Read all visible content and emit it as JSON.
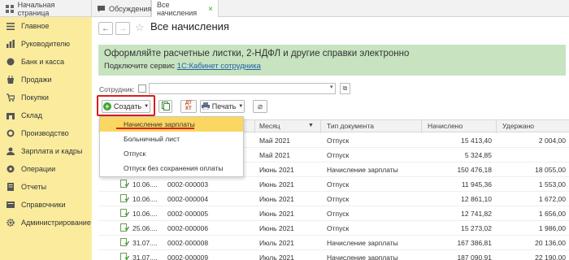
{
  "tabs": [
    {
      "label": "Начальная страница"
    },
    {
      "label": "Обсуждения"
    },
    {
      "label": "Все начисления",
      "close": "×"
    }
  ],
  "sidebar": {
    "items": [
      {
        "label": "Главное",
        "icon": "menu-icon"
      },
      {
        "label": "Руководителю",
        "icon": "chart-icon"
      },
      {
        "label": "Банк и касса",
        "icon": "bank-icon"
      },
      {
        "label": "Продажи",
        "icon": "sales-icon"
      },
      {
        "label": "Покупки",
        "icon": "purchase-icon"
      },
      {
        "label": "Склад",
        "icon": "warehouse-icon"
      },
      {
        "label": "Производство",
        "icon": "production-icon"
      },
      {
        "label": "Зарплата и кадры",
        "icon": "salary-icon"
      },
      {
        "label": "Операции",
        "icon": "operations-icon"
      },
      {
        "label": "Отчеты",
        "icon": "reports-icon"
      },
      {
        "label": "Справочники",
        "icon": "directory-icon"
      },
      {
        "label": "Администрирование",
        "icon": "admin-icon"
      }
    ]
  },
  "header": {
    "back": "←",
    "forward": "→",
    "star": "☆",
    "title": "Все начисления"
  },
  "banner": {
    "headline": "Оформляйте расчетные листки, 2-НДФЛ и другие справки электронно",
    "prefix": "Подключите сервис ",
    "link": "1С:Кабинет сотрудника"
  },
  "filter": {
    "employee_label": "Сотрудник:",
    "employee_value": ""
  },
  "toolbar": {
    "create_label": "Создать",
    "print_label": "Печать"
  },
  "dropdown": {
    "items": [
      "Начисление зарплаты",
      "Больничный лист",
      "Отпуск",
      "Отпуск без сохранения оплаты"
    ]
  },
  "table": {
    "columns": [
      "Месяц",
      "Тип документа",
      "Начислено",
      "Удержано"
    ],
    "rows": [
      {
        "date": "",
        "number": "",
        "month": "Май 2021",
        "type": "Отпуск",
        "accrued": "15 413,40",
        "withheld": "2 004,00"
      },
      {
        "date": "",
        "number": "",
        "month": "Май 2021",
        "type": "Отпуск",
        "accrued": "5 324,85",
        "withheld": ""
      },
      {
        "date": "",
        "number": "",
        "month": "Июнь 2021",
        "type": "Начисление зарплаты",
        "accrued": "150 476,18",
        "withheld": "18 055,00"
      },
      {
        "date": "10.06....",
        "number": "0002-000003",
        "month": "Июнь 2021",
        "type": "Отпуск",
        "accrued": "11 945,36",
        "withheld": "1 553,00"
      },
      {
        "date": "10.06....",
        "number": "0002-000004",
        "month": "Июнь 2021",
        "type": "Отпуск",
        "accrued": "12 861,10",
        "withheld": "1 672,00"
      },
      {
        "date": "10.06....",
        "number": "0002-000005",
        "month": "Июнь 2021",
        "type": "Отпуск",
        "accrued": "12 741,82",
        "withheld": "1 656,00"
      },
      {
        "date": "25.06....",
        "number": "0002-000006",
        "month": "Июнь 2021",
        "type": "Отпуск",
        "accrued": "15 273,02",
        "withheld": "1 986,00"
      },
      {
        "date": "31.07....",
        "number": "0002-000008",
        "month": "Июль 2021",
        "type": "Начисление зарплаты",
        "accrued": "167 386,81",
        "withheld": "20 136,00"
      },
      {
        "date": "31.07....",
        "number": "0002-000009",
        "month": "Июль 2021",
        "type": "Начисление зарплаты",
        "accrued": "187 090,91",
        "withheld": "22 190,00"
      }
    ]
  },
  "colors": {
    "sidebar_bg": "#fbec9d",
    "banner_bg": "#c7e3c0",
    "highlight": "#fbd661",
    "accent_red": "#d81e1e",
    "link": "#2162a8"
  }
}
